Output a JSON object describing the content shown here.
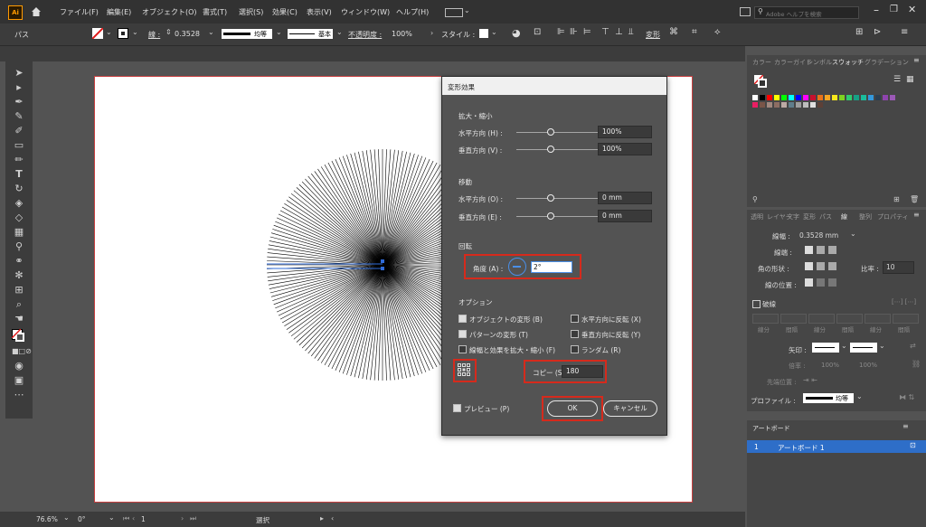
{
  "menu": {
    "app_icon": "Ai",
    "items": [
      "ファイル(F)",
      "編集(E)",
      "オブジェクト(O)",
      "書式(T)",
      "選択(S)",
      "効果(C)",
      "表示(V)",
      "ウィンドウ(W)",
      "ヘルプ(H)"
    ],
    "search_placeholder": "Adobe ヘルプを検索"
  },
  "control": {
    "object_type": "パス",
    "stroke_label": "線 :",
    "stroke_value": "0.3528",
    "profile_label": "均等",
    "brush_label": "基本",
    "opacity_label": "不透明度 :",
    "opacity_value": "100%",
    "style_label": "スタイル :",
    "transform_label": "変形"
  },
  "dialog": {
    "title": "変形効果",
    "scale_section": "拡大・縮小",
    "h_scale_label": "水平方向 (H) :",
    "h_scale_value": "100%",
    "v_scale_label": "垂直方向 (V) :",
    "v_scale_value": "100%",
    "move_section": "移動",
    "h_move_label": "水平方向 (O) :",
    "h_move_value": "0 mm",
    "v_move_label": "垂直方向 (E) :",
    "v_move_value": "0 mm",
    "rotate_section": "回転",
    "angle_label": "角度 (A) :",
    "angle_value": "2°",
    "options_section": "オプション",
    "opt_transform_objects": "オブジェクトの変形 (B)",
    "opt_transform_patterns": "パターンの変形 (T)",
    "opt_scale_strokes": "線幅と効果を拡大・縮小 (F)",
    "opt_reflect_x": "水平方向に反転 (X)",
    "opt_reflect_y": "垂直方向に反転 (Y)",
    "opt_random": "ランダム (R)",
    "copies_label": "コピー (S)",
    "copies_value": "180",
    "preview_label": "プレビュー (P)",
    "ok_label": "OK",
    "cancel_label": "キャンセル"
  },
  "swatches_panel": {
    "tabs": [
      "カラー",
      "カラーガイド",
      "シンボル",
      "スウォッチ",
      "グラデーション"
    ],
    "active_tab": "スウォッチ",
    "colors": [
      "#ffffff",
      "#000000",
      "#ff0000",
      "#ffff00",
      "#00ff00",
      "#00ffff",
      "#0000ff",
      "#ff00ff",
      "#c8102e",
      "#e8731a",
      "#f5a623",
      "#f8e71c",
      "#7ed321",
      "#2ecc71",
      "#16a085",
      "#1abc9c",
      "#3498db",
      "#2c3e50",
      "#8e44ad",
      "#9b59b6",
      "#e91e63",
      "#795548",
      "#a1887f",
      "#8d6e63",
      "#bcaaa4",
      "#607d8b",
      "#9e9e9e",
      "#bdbdbd",
      "#e0e0e0",
      "#5d4037"
    ]
  },
  "props_panel": {
    "tabs": [
      "透明",
      "レイヤー",
      "文字",
      "変形",
      "パス",
      "線",
      "整列",
      "プロパティ"
    ],
    "active_tab": "線",
    "weight_label": "線幅 :",
    "weight_value": "0.3528 mm",
    "cap_label": "線端 :",
    "corner_label": "角の形状 :",
    "limit_label": "比率 :",
    "limit_value": "10",
    "align_label": "線の位置 :",
    "dashed_label": "破線",
    "dash_cols": [
      "線分",
      "間隔",
      "線分",
      "間隔",
      "線分",
      "間隔"
    ],
    "arrow_label": "矢印 :",
    "scale_label": "倍率 :",
    "scale_value_1": "100%",
    "scale_value_2": "100%",
    "align_arrow_label": "先端位置 :",
    "profile_label": "プロファイル :",
    "profile_value": "均等"
  },
  "artboards_panel": {
    "title": "アートボード",
    "rows": [
      {
        "index": "1",
        "name": "アートボード 1"
      }
    ]
  },
  "status": {
    "zoom": "76.6%",
    "rotation": "0°",
    "artboard_num": "1",
    "tool_name": "選択"
  }
}
